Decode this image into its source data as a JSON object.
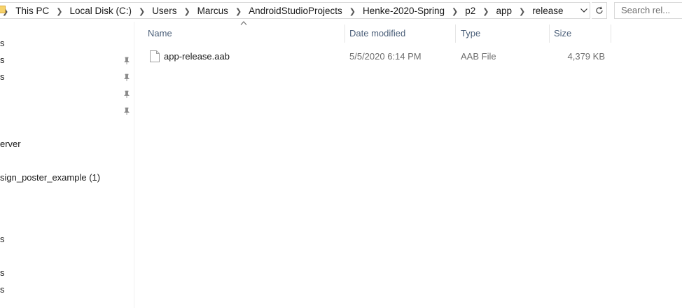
{
  "address_bar": {
    "crumbs": [
      "This PC",
      "Local Disk (C:)",
      "Users",
      "Marcus",
      "AndroidStudioProjects",
      "Henke-2020-Spring",
      "p2",
      "app",
      "release"
    ]
  },
  "search": {
    "placeholder": "Search rel..."
  },
  "nav": {
    "items": [
      {
        "label": "s",
        "pinned": false
      },
      {
        "label": "s",
        "pinned": true
      },
      {
        "label": "s",
        "pinned": true
      },
      {
        "label": "",
        "pinned": true
      },
      {
        "label": "",
        "pinned": true
      },
      {
        "label": "erver",
        "pinned": false
      },
      {
        "label": "sign_poster_example (1)",
        "pinned": false
      },
      {
        "label": "s",
        "pinned": false
      },
      {
        "label": "s",
        "pinned": false
      },
      {
        "label": "s",
        "pinned": false
      }
    ]
  },
  "columns": {
    "name": "Name",
    "date": "Date modified",
    "type": "Type",
    "size": "Size"
  },
  "files": [
    {
      "name": "app-release.aab",
      "date": "5/5/2020 6:14 PM",
      "type": "AAB File",
      "size": "4,379 KB"
    }
  ]
}
